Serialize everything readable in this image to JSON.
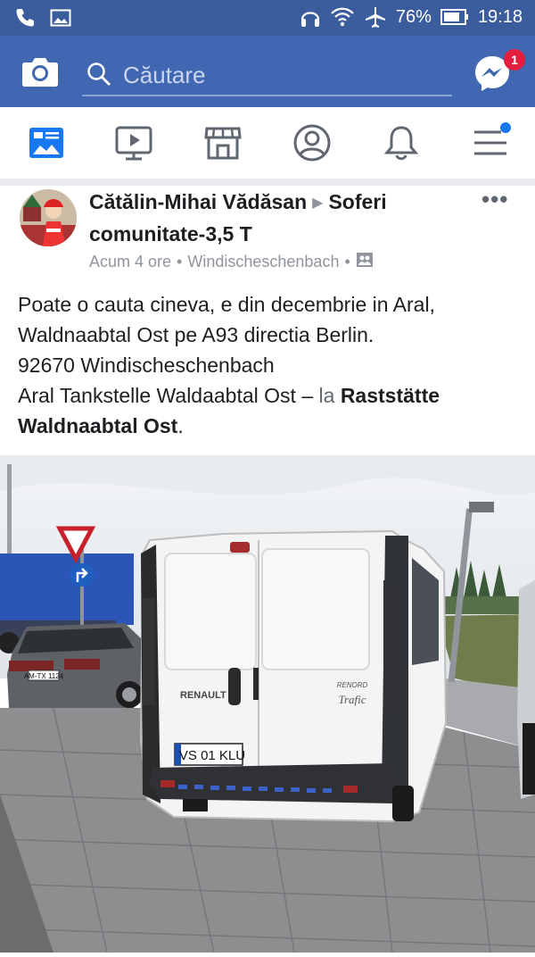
{
  "status_bar": {
    "battery_percent": "76%",
    "time": "19:18",
    "icons": [
      "phone-icon",
      "image-icon",
      "headphones-icon",
      "wifi-icon",
      "airplane-icon",
      "battery-icon"
    ]
  },
  "top_bar": {
    "search_placeholder": "Căutare",
    "messenger_badge": "1",
    "colors": {
      "bar": "#4267b2",
      "status": "#3b5d9e",
      "badge": "#e41e3f"
    }
  },
  "nav": {
    "tabs": [
      "news-feed-icon",
      "watch-icon",
      "marketplace-icon",
      "profile-icon",
      "notifications-icon",
      "menu-icon"
    ]
  },
  "post": {
    "author": "Cătălin-Mihai Vădăsan",
    "group": "Soferi comunitate-3,5 T",
    "time": "Acum 4 ore",
    "location": "Windischeschenbach",
    "more": "•••",
    "text": {
      "line1": "Poate o cauta cineva, e din decembrie in Aral,",
      "line2": "Waldnaabtal Ost pe A93 directia Berlin.",
      "line3": "92670 Windischeschenbach",
      "line4_pre": "Aral Tankstelle Waldaabtal Ost",
      "line4_dash": " – ",
      "line4_la": "la ",
      "place_a": "Raststätte",
      "place_b": "Waldnaabtal Ost",
      "period": "."
    }
  },
  "photo": {
    "plate_van": "VS 01 KLU",
    "plate_car": "AM-TX 1124",
    "van_brand": "RENAULT",
    "van_model": "Trafic",
    "van_badge": "RENORD"
  }
}
